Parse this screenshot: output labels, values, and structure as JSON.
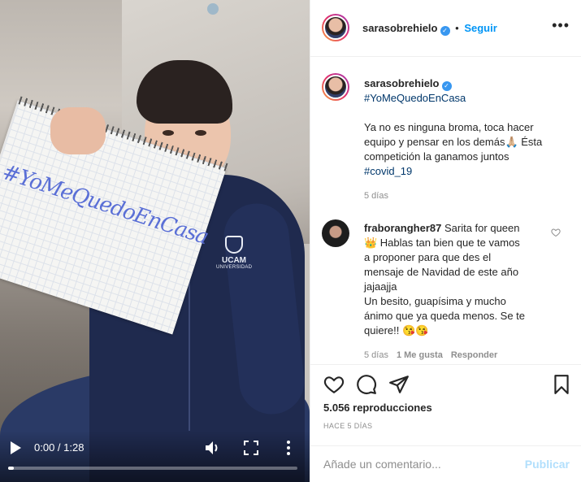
{
  "video": {
    "notebook_text": "#YoMeQuedoEnCasa",
    "logo_text": "UCAM",
    "logo_sub": "UNIVERSIDAD",
    "time_display": "0:00 / 1:28",
    "progress_fraction": 0.0
  },
  "header": {
    "username": "sarasobrehielo",
    "separator": "•",
    "follow_label": "Seguir",
    "menu_icon": "ellipsis-icon"
  },
  "caption": {
    "username": "sarasobrehielo",
    "hashtag": "#YoMeQuedoEnCasa",
    "text_line1": "Ya no es ninguna broma, toca hacer",
    "text_line2": "equipo y pensar en los demás🙏🏼 Ésta",
    "text_line3": "competición la ganamos juntos",
    "hashtag2": "#covid_19",
    "time": "5 días"
  },
  "comment": {
    "username": "fraborangher87",
    "line1": " Sarita for queen",
    "line2": "👑 Hablas tan bien que te vamos",
    "line3": "a proponer para que des el",
    "line4": "mensaje de Navidad de este año",
    "line5": "jajaajja",
    "line6": "Un besito, guapísima y mucho",
    "line7": "ánimo que ya queda menos. Se te",
    "line8": "quiere!! 😘😘",
    "time": "5 días",
    "likes": "1 Me gusta",
    "reply": "Responder"
  },
  "actions": {
    "views": "5.056 reproducciones",
    "posted_ago": "HACE 5 DÍAS"
  },
  "add_comment": {
    "placeholder": "Añade un comentario...",
    "publish_label": "Publicar"
  }
}
